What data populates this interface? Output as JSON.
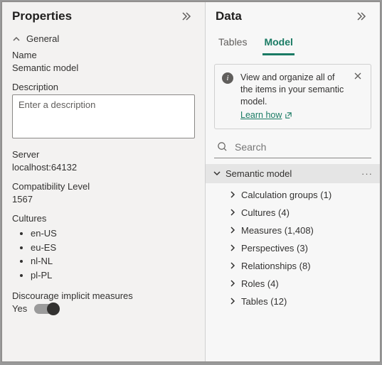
{
  "properties": {
    "title": "Properties",
    "general_section": "General",
    "name_label": "Name",
    "name_value": "Semantic model",
    "description_label": "Description",
    "description_placeholder": "Enter a description",
    "server_label": "Server",
    "server_value": "localhost:64132",
    "compat_label": "Compatibility Level",
    "compat_value": "1567",
    "cultures_label": "Cultures",
    "cultures": [
      "en-US",
      "eu-ES",
      "nl-NL",
      "pl-PL"
    ],
    "discourage_label": "Discourage implicit measures",
    "discourage_value": "Yes"
  },
  "data": {
    "title": "Data",
    "tabs": {
      "tables": "Tables",
      "model": "Model"
    },
    "info_text": "View and organize all of the items in your semantic model.",
    "learn_how": "Learn how",
    "search_placeholder": "Search",
    "root_label": "Semantic model",
    "items": [
      {
        "label": "Calculation groups",
        "count": 1
      },
      {
        "label": "Cultures",
        "count": 4
      },
      {
        "label": "Measures",
        "count": 1408
      },
      {
        "label": "Perspectives",
        "count": 3
      },
      {
        "label": "Relationships",
        "count": 8
      },
      {
        "label": "Roles",
        "count": 4
      },
      {
        "label": "Tables",
        "count": 12
      }
    ]
  }
}
